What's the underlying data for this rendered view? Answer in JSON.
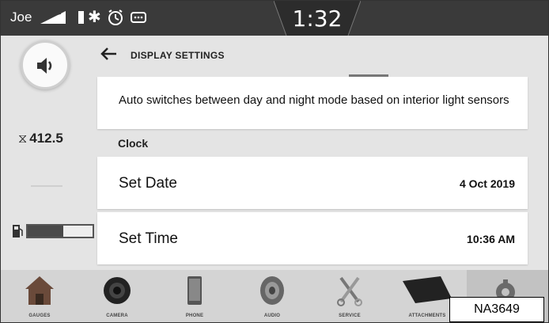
{
  "status_bar": {
    "user": "Joe",
    "time": "1:32",
    "icons": [
      "signal-icon",
      "battery-icon",
      "bluetooth-icon",
      "alarm-clock-icon",
      "message-icon"
    ]
  },
  "left_rail": {
    "volume_icon": "speaker-icon",
    "engine_hours": "412.5",
    "hours_icon": "hourglass-icon",
    "fuel_icon": "fuel-pump-icon",
    "fuel_level_fraction": 0.55
  },
  "header": {
    "back_icon": "arrow-left-icon",
    "title": "DISPLAY SETTINGS"
  },
  "content": {
    "description": "Auto switches between day and night mode based on interior light sensors",
    "section_title": "Clock",
    "rows": [
      {
        "label": "Set Date",
        "value": "4 Oct 2019"
      },
      {
        "label": "Set Time",
        "value": "10:36 AM"
      }
    ]
  },
  "nav": {
    "items": [
      {
        "label": "GAUGES",
        "icon": "house-icon"
      },
      {
        "label": "CAMERA",
        "icon": "camera-icon"
      },
      {
        "label": "PHONE",
        "icon": "phone-icon"
      },
      {
        "label": "AUDIO",
        "icon": "speaker-cone-icon"
      },
      {
        "label": "SERVICE",
        "icon": "tools-icon"
      },
      {
        "label": "ATTACHMENTS",
        "icon": "bucket-icon"
      },
      {
        "label": "",
        "icon": "settings-gear-icon"
      }
    ]
  },
  "figure_label": "NA3649",
  "colors": {
    "status_bar": "#3a3a3a",
    "background": "#e4e4e4",
    "card": "#ffffff",
    "nav": "#d4d4d4"
  }
}
